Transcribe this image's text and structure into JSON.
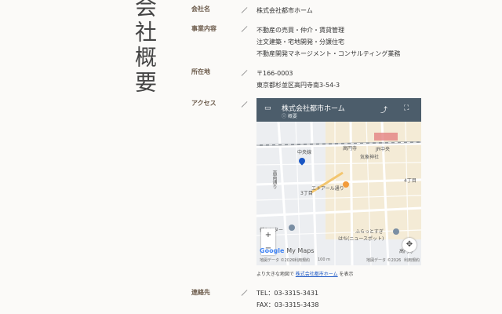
{
  "page_title": "会社概要",
  "rows": {
    "company": {
      "label": "会社名",
      "value": "株式会社都市ホーム"
    },
    "business": {
      "label": "事業内容",
      "lines": [
        "不動産の売買・仲介・賃貸管理",
        "注文建築・宅地開発・分譲住宅",
        "不動産開発マネージメント・コンサルティング業務"
      ]
    },
    "address": {
      "label": "所在地",
      "lines": [
        "〒166-0003",
        "東京都杉並区高円寺南3-54-3"
      ]
    },
    "access": {
      "label": "アクセス"
    },
    "contact": {
      "label": "連絡先",
      "lines": [
        "TEL：03-3315-3431",
        "FAX：03-3315-3438"
      ]
    }
  },
  "map": {
    "title": "株式会社都市ホーム",
    "subtitle": "概要",
    "labels": [
      "中央線",
      "高円寺",
      "JR中央",
      "気象神社",
      "エトアール通り",
      "3丁目",
      "4丁目",
      "高円寺",
      "ふらっとすぎ",
      "はち(ニュースポット)",
      "健センター",
      "高南通り"
    ],
    "attribution_left": "地図データ ©2026",
    "attribution_right": "地図データ ©2026",
    "scale": "100 m",
    "terms": "利用規約",
    "brand": "Google",
    "brand_suffix": "My Maps"
  },
  "link": {
    "prefix": "より大きな地図で ",
    "anchor": "株式会社都市ホーム",
    "suffix": " を表示"
  }
}
